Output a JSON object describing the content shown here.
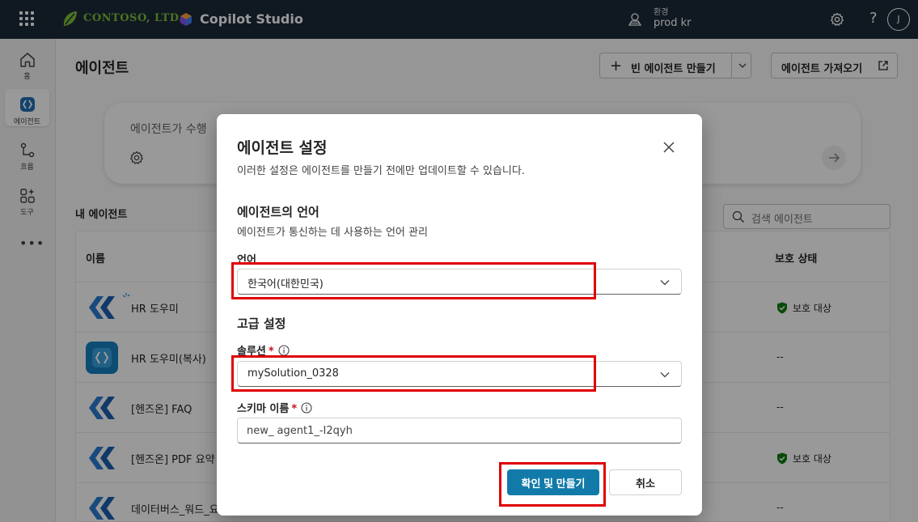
{
  "topbar": {
    "company": "CONTOSO, LTD.",
    "product": "Copilot Studio",
    "env_label": "환경",
    "env_value": "prod kr",
    "help": "?",
    "avatar": "J"
  },
  "rail": [
    {
      "label": "홈",
      "icon": "home-icon"
    },
    {
      "label": "에이전트",
      "icon": "agent-icon"
    },
    {
      "label": "흐름",
      "icon": "flow-icon"
    },
    {
      "label": "도구",
      "icon": "tools-icon"
    }
  ],
  "rail_more": "•••",
  "page": {
    "title": "에이전트",
    "new_agent": "빈 에이전트 만들기",
    "import_agent": "에이전트 가져오기",
    "prompt_placeholder": "에이전트가 수행",
    "my_agents": "내 에이전트",
    "search_placeholder": "검색 에이전트"
  },
  "table": {
    "col_name": "이름",
    "col_protection": "보호 상태",
    "rows": [
      {
        "name": "HR 도우미",
        "protection": "보호 대상",
        "logo": "light"
      },
      {
        "name": "HR 도우미(복사)",
        "protection": "--",
        "logo": "tile"
      },
      {
        "name": "[헨즈온] FAQ",
        "protection": "--",
        "logo": "light"
      },
      {
        "name": "[헨즈온] PDF 요약",
        "protection": "보호 대상",
        "logo": "light"
      },
      {
        "name": "데이터버스_워드_요",
        "protection": "--",
        "logo": "light"
      }
    ]
  },
  "dialog": {
    "title": "에이전트 설정",
    "subtitle": "이러한 설정은 에이전트를 만들기 전에만 업데이트할 수 있습니다.",
    "lang_section": "에이전트의 언어",
    "lang_desc": "에이전트가 통신하는 데 사용하는 언어 관리",
    "lang_label": "언어",
    "lang_value": "한국어(대한민국)",
    "adv_section": "고급 설정",
    "solution_label": "솔루션",
    "solution_value": "mySolution_0328",
    "schema_label": "스키마 이름",
    "schema_value": "new_ agent1_-I2qyh",
    "required": "*",
    "confirm": "확인 및 만들기",
    "cancel": "취소"
  },
  "colors": {
    "topbar": "#1b2b3a",
    "brand_green": "#7fbf3a",
    "primary": "#117aa8",
    "highlight": "#e00000",
    "shield": "#107c10"
  }
}
